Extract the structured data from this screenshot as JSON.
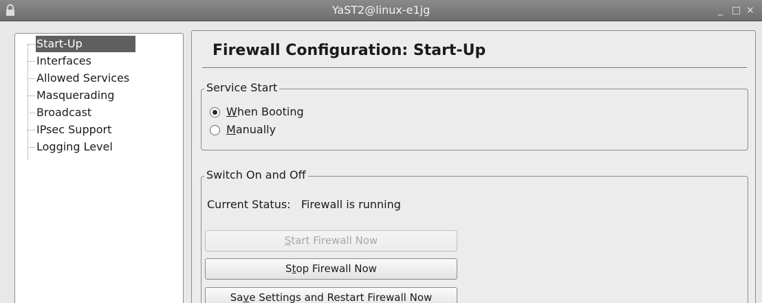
{
  "window": {
    "title": "YaST2@linux-e1jg",
    "minimize_glyph": "_",
    "maximize_glyph": "□",
    "close_glyph": "×",
    "lock_icon": "lock-icon"
  },
  "tree": {
    "items": [
      {
        "label": "Start-Up",
        "selected": true
      },
      {
        "label": "Interfaces"
      },
      {
        "label": "Allowed Services"
      },
      {
        "label": "Masquerading"
      },
      {
        "label": "Broadcast"
      },
      {
        "label": "IPsec Support"
      },
      {
        "label": "Logging Level"
      }
    ]
  },
  "main": {
    "heading": "Firewall Configuration: Start-Up",
    "service_start": {
      "title": "Service Start",
      "options": [
        {
          "mnemonic": "W",
          "rest": "hen Booting",
          "checked": true
        },
        {
          "mnemonic": "M",
          "rest": "anually",
          "checked": false
        }
      ]
    },
    "switch": {
      "title": "Switch On and Off",
      "status_label": "Current Status:",
      "status_value": "Firewall is running",
      "buttons": {
        "start": {
          "pre": "",
          "mnemonic": "S",
          "post": "tart Firewall Now",
          "enabled": false
        },
        "stop": {
          "pre": "S",
          "mnemonic": "t",
          "post": "op Firewall Now",
          "enabled": true
        },
        "save": {
          "pre": "Sa",
          "mnemonic": "v",
          "post": "e Settings and Restart Firewall Now",
          "enabled": true
        }
      }
    }
  },
  "colors": {
    "selection": "#5f5f5f",
    "titlebar": "#7a7a7a"
  }
}
